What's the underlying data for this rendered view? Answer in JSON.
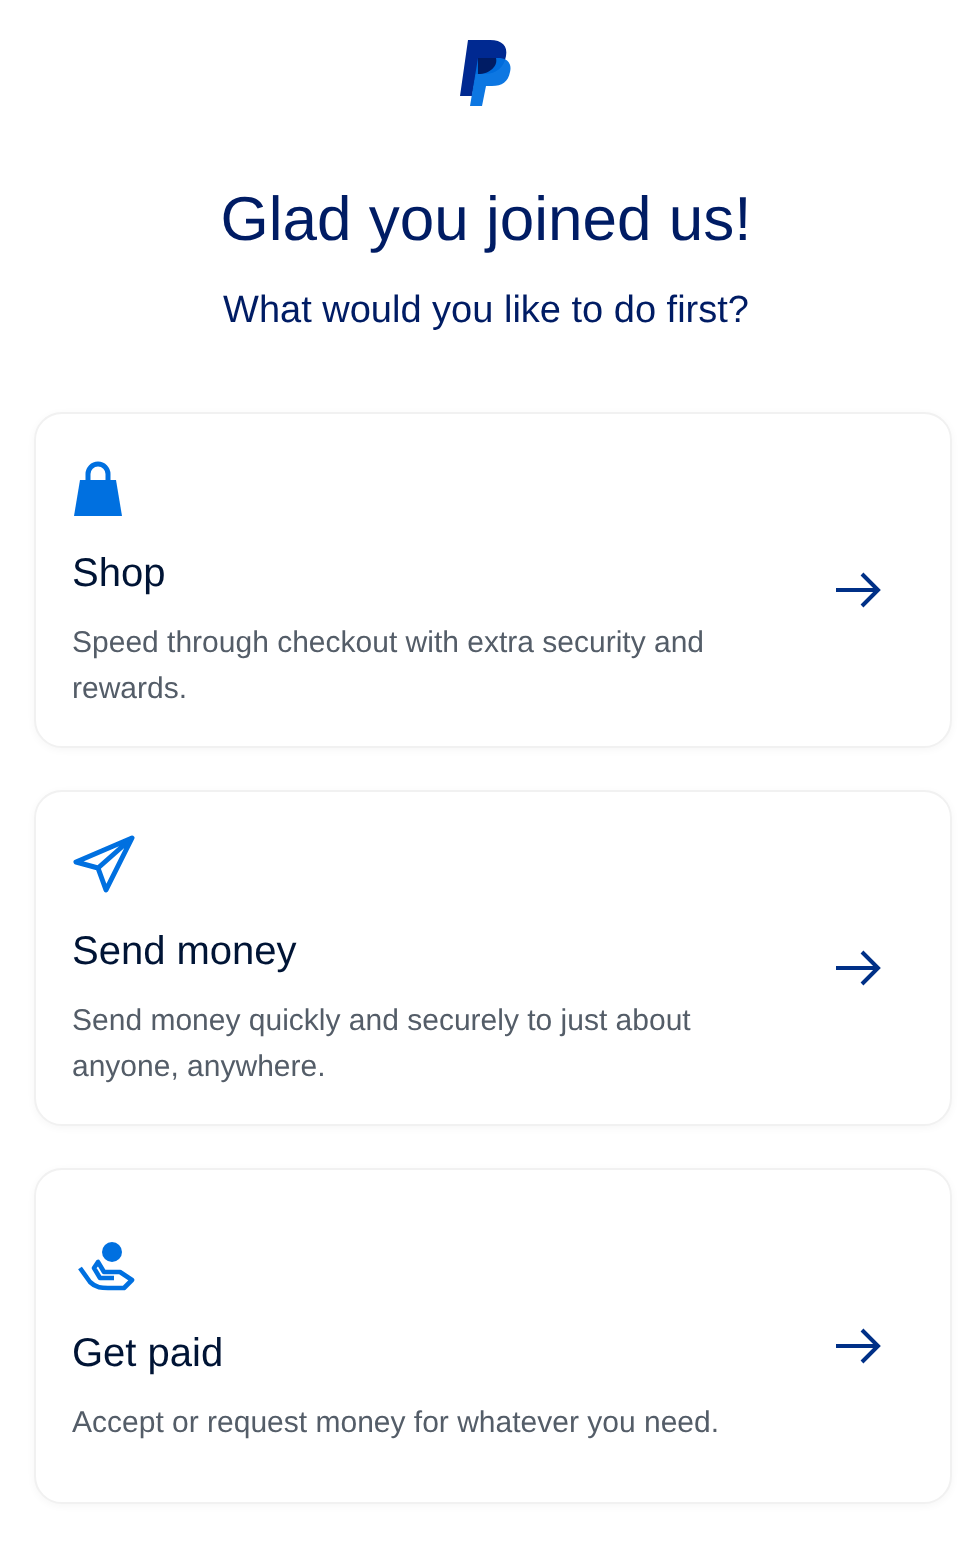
{
  "heading": "Glad you joined us!",
  "subheading": "What would you like to do first?",
  "options": [
    {
      "kind": "shop",
      "title": "Shop",
      "description": "Speed through checkout with extra security and rewards."
    },
    {
      "kind": "send",
      "title": "Send money",
      "description": "Send money quickly and securely to just about anyone, anywhere."
    },
    {
      "kind": "receive",
      "title": "Get paid",
      "description": "Accept or request money for whatever you need."
    }
  ]
}
